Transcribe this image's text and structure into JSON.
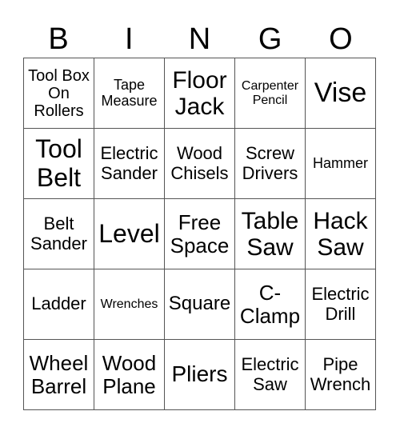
{
  "header": [
    "B",
    "I",
    "N",
    "G",
    "O"
  ],
  "rows": [
    [
      "Tool Box On Rollers",
      "Tape Measure",
      "Floor Jack",
      "Carpenter Pencil",
      "Vise"
    ],
    [
      "Tool Belt",
      "Electric Sander",
      "Wood Chisels",
      "Screw Drivers",
      "Hammer"
    ],
    [
      "Belt Sander",
      "Level",
      "Free Space",
      "Table Saw",
      "Hack Saw"
    ],
    [
      "Ladder",
      "Wrenches",
      "Square",
      "C-Clamp",
      "Electric Drill"
    ],
    [
      "Wheel Barrel",
      "Wood Plane",
      "Pliers",
      "Electric Saw",
      "Pipe Wrench"
    ]
  ]
}
